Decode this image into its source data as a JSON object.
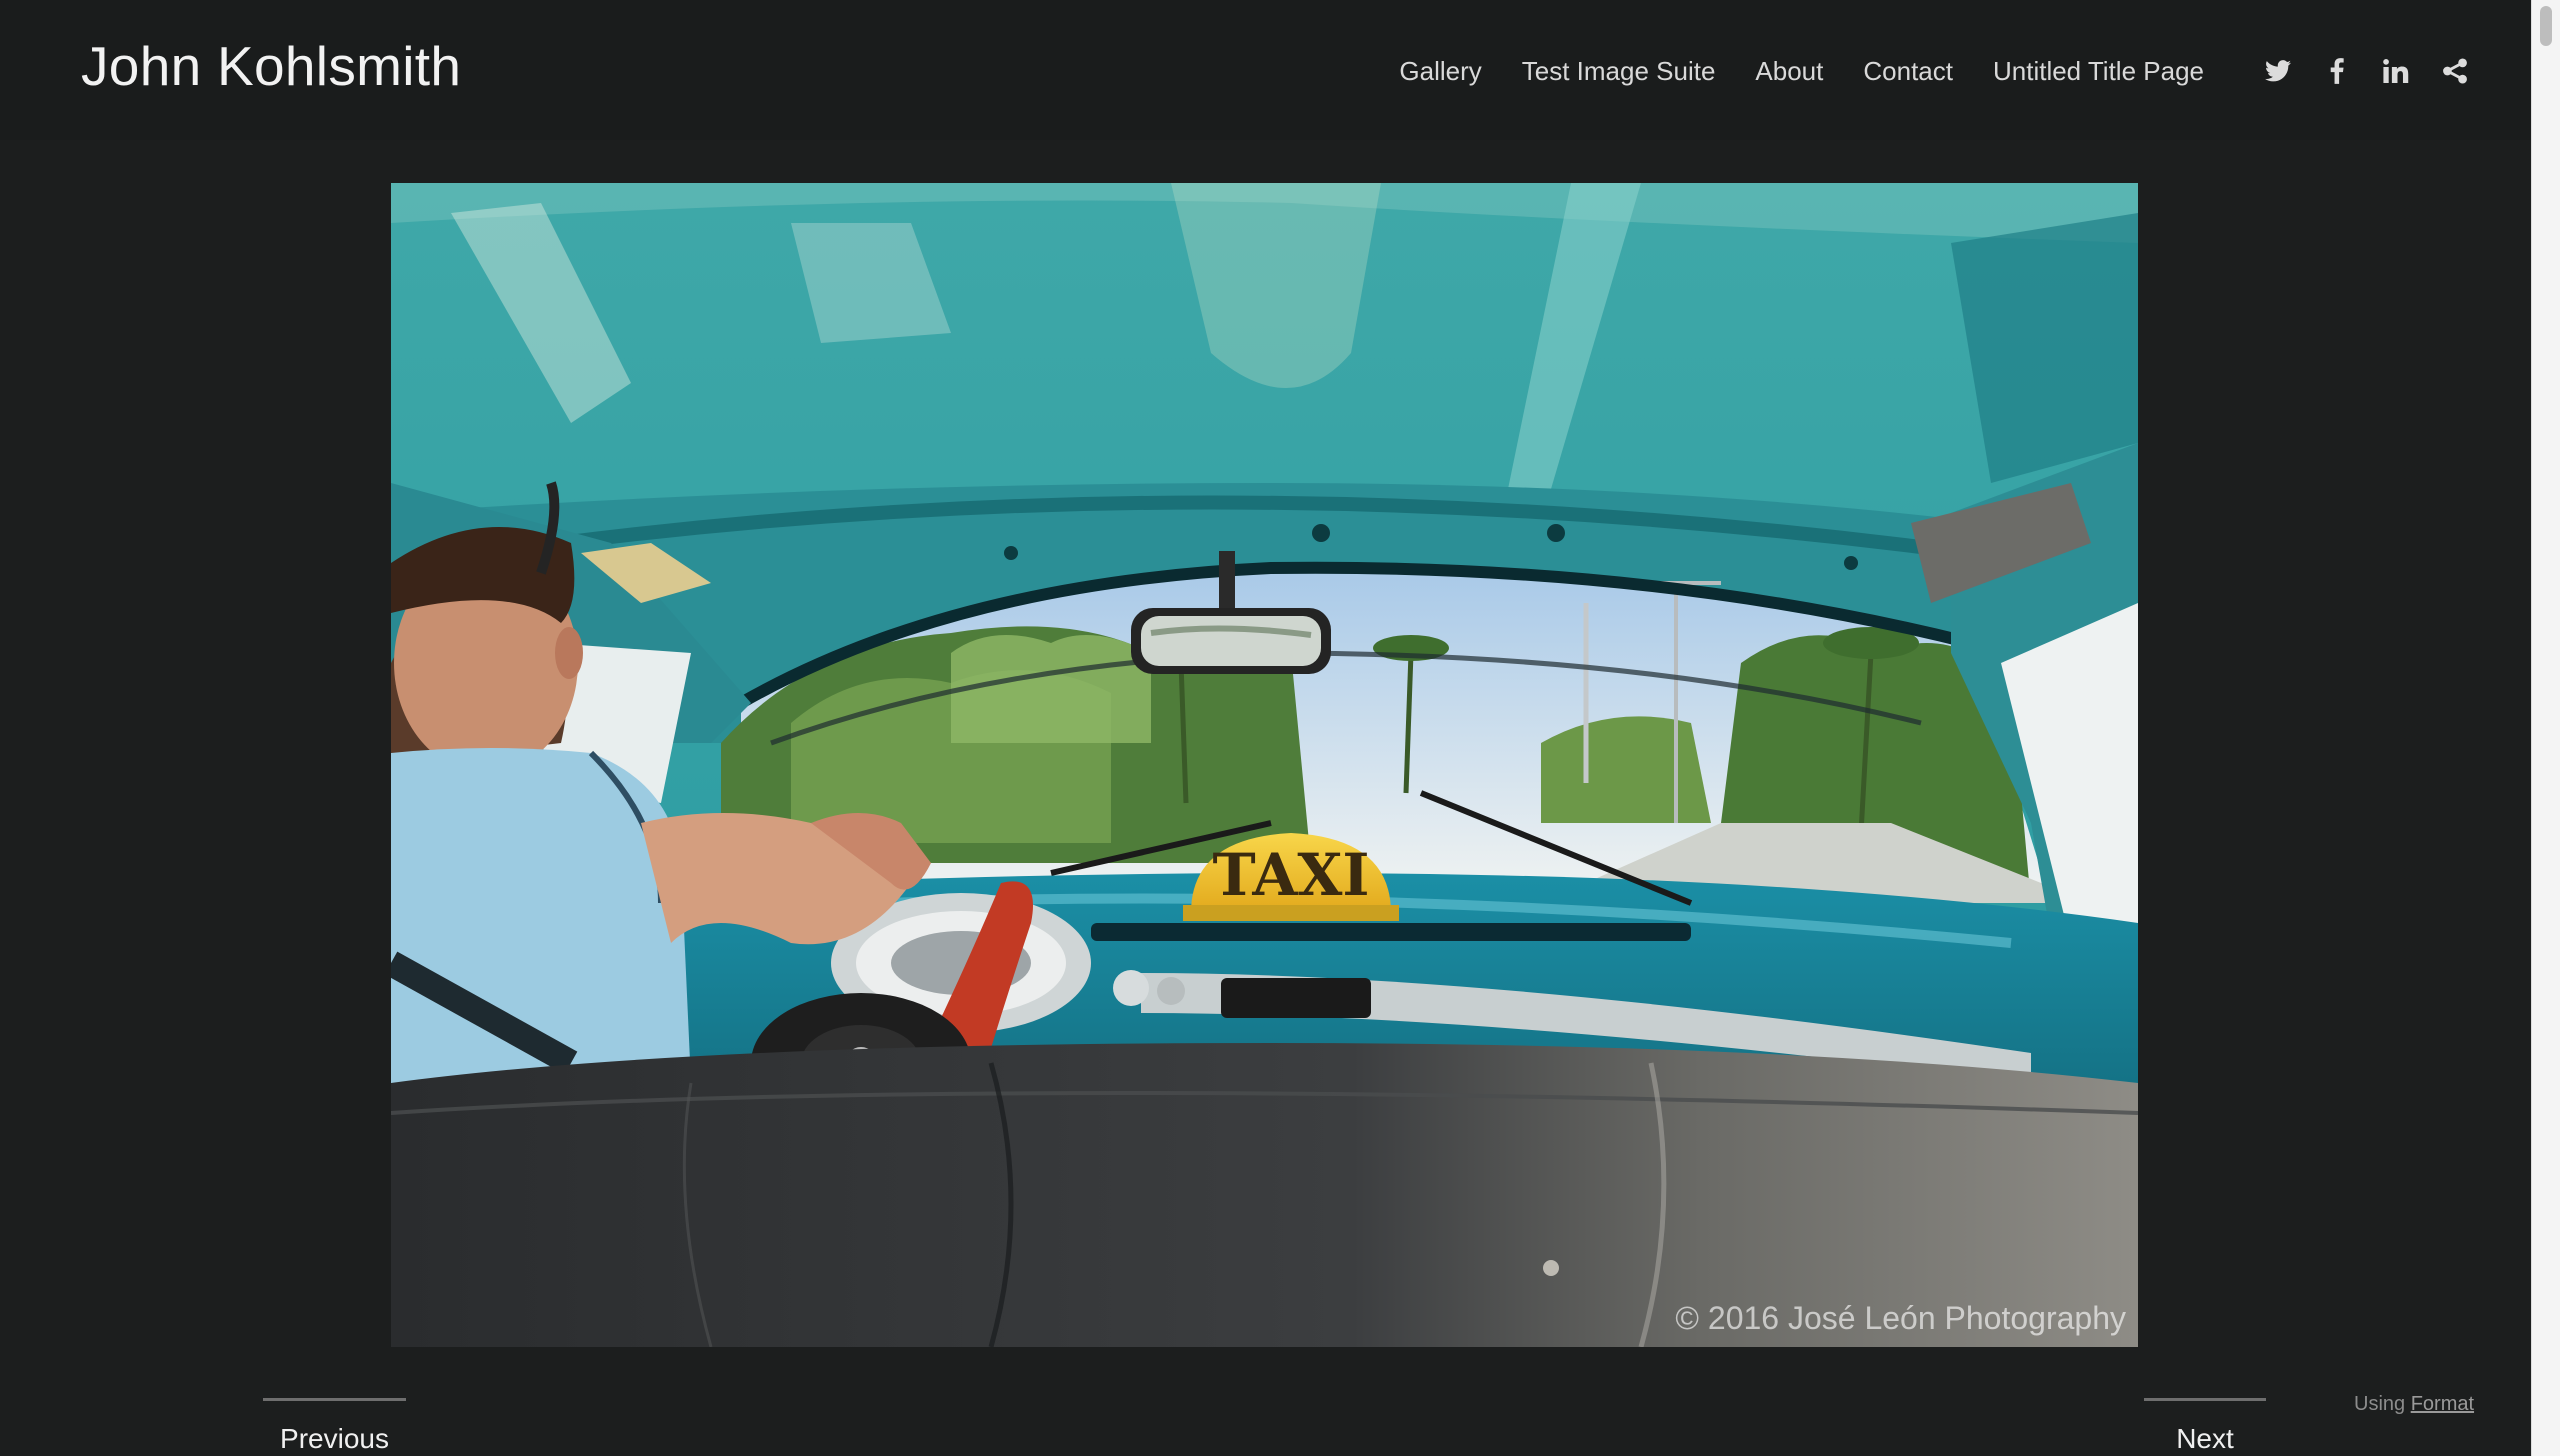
{
  "site": {
    "title": "John Kohlsmith"
  },
  "nav": {
    "links": [
      "Gallery",
      "Test Image Suite",
      "About",
      "Contact",
      "Untitled Title Page"
    ],
    "social_icons": [
      "twitter-icon",
      "facebook-icon",
      "linkedin-icon",
      "share-icon"
    ]
  },
  "photo": {
    "sign_text": "TAXI",
    "watermark": "© 2016 José León Photography"
  },
  "pager": {
    "previous": "Previous",
    "next": "Next"
  },
  "footer": {
    "using_label": "Using",
    "format_link": "Format"
  },
  "colors": {
    "background": "#1c1e1e",
    "header": "#1a1c1c",
    "text": "#e8e8e8",
    "nav_text": "#d9d9d9",
    "muted": "#8c8c8c"
  }
}
